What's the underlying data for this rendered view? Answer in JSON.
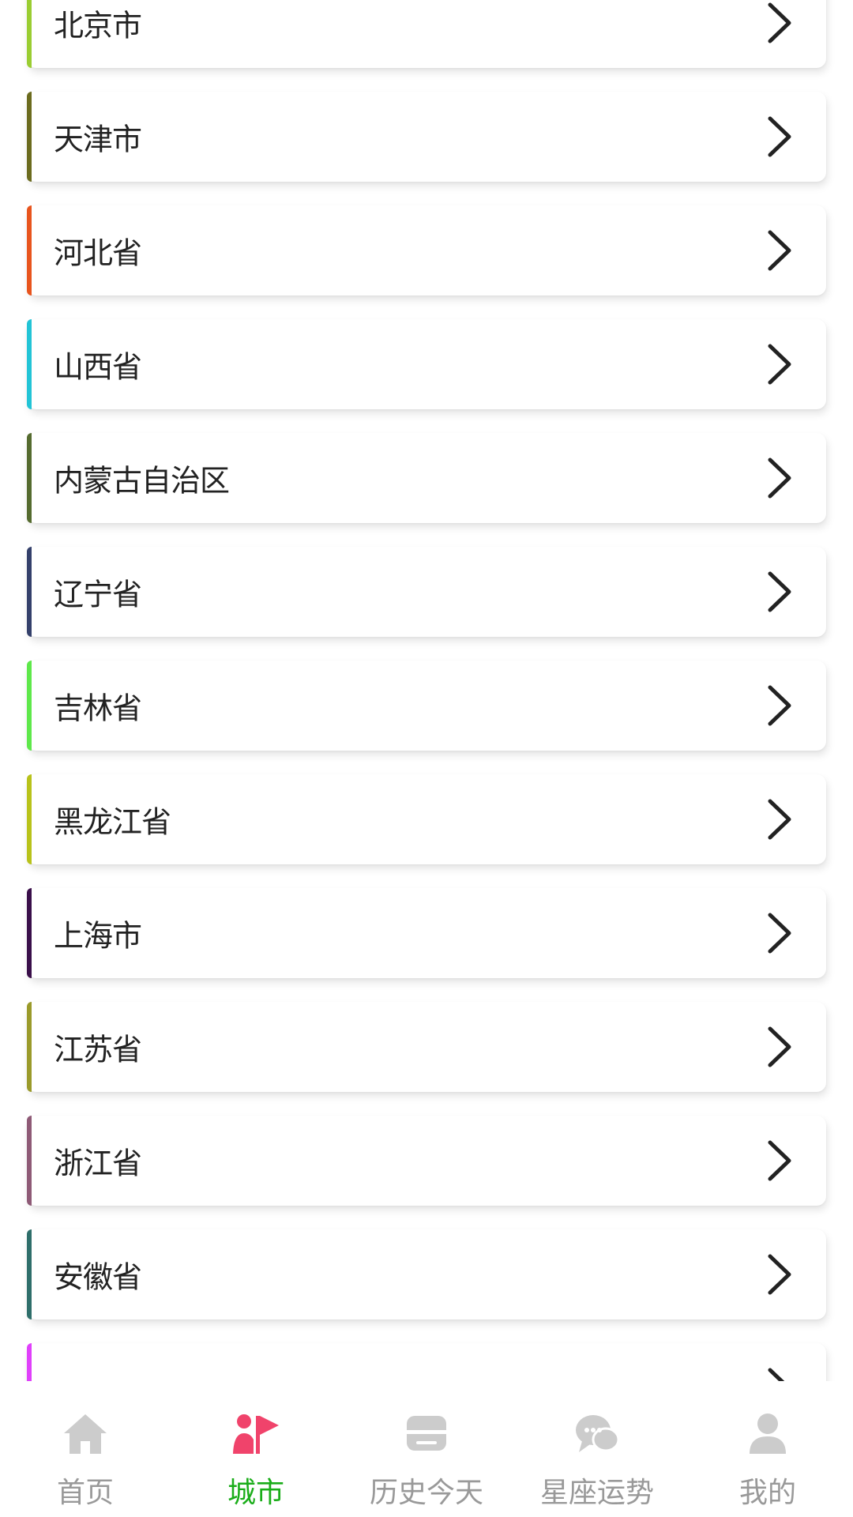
{
  "provinces": [
    {
      "name": "北京市",
      "color": "#9acd32"
    },
    {
      "name": "天津市",
      "color": "#6b6b1e"
    },
    {
      "name": "河北省",
      "color": "#e8541d"
    },
    {
      "name": "山西省",
      "color": "#22c4d6"
    },
    {
      "name": "内蒙古自治区",
      "color": "#556b2f"
    },
    {
      "name": "辽宁省",
      "color": "#34406b"
    },
    {
      "name": "吉林省",
      "color": "#5ee84a"
    },
    {
      "name": "黑龙江省",
      "color": "#b8c21a"
    },
    {
      "name": "上海市",
      "color": "#3a0f4a"
    },
    {
      "name": "江苏省",
      "color": "#9a9a2a"
    },
    {
      "name": "浙江省",
      "color": "#8e5a76"
    },
    {
      "name": "安徽省",
      "color": "#2e6e6a"
    },
    {
      "name": "",
      "color": "#e040fb"
    }
  ],
  "row_icon": "chevron-right-icon",
  "tabbar": {
    "active_color": "#1aad19",
    "inactive_color": "#999999",
    "tabs": [
      {
        "label": "首页",
        "icon": "home-icon",
        "active": false
      },
      {
        "label": "城市",
        "icon": "city-flag-icon",
        "active": true
      },
      {
        "label": "历史今天",
        "icon": "history-icon",
        "active": false
      },
      {
        "label": "星座运势",
        "icon": "chat-icon",
        "active": false
      },
      {
        "label": "我的",
        "icon": "user-icon",
        "active": false
      }
    ]
  }
}
